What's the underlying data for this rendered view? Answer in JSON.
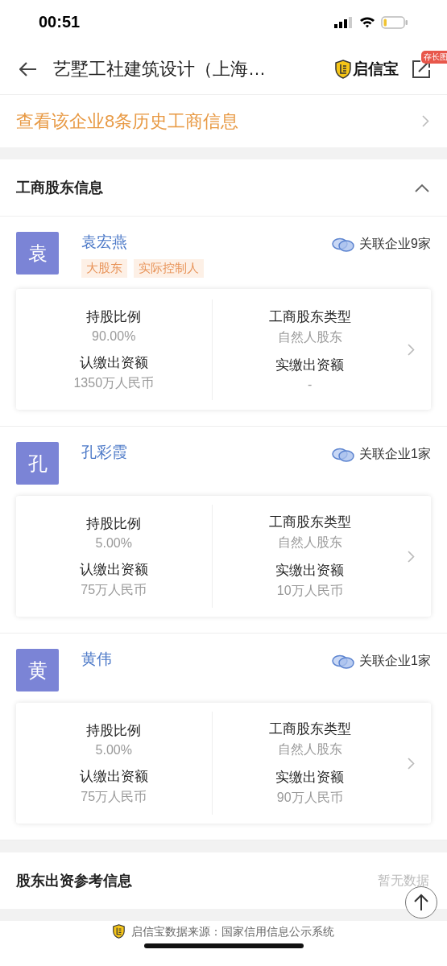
{
  "status_bar": {
    "time": "00:51"
  },
  "nav": {
    "title": "艺墅工社建筑设计（上海…",
    "brand": "启信宝",
    "badge": "存长图"
  },
  "history_link": "查看该企业8条历史工商信息",
  "section": {
    "title": "工商股东信息",
    "expanded": true
  },
  "shareholders": [
    {
      "avatar": "袁",
      "name": "袁宏燕",
      "tags": [
        "大股东",
        "实际控制人"
      ],
      "related": "关联企业9家",
      "fields": [
        {
          "label": "持股比例",
          "value": "90.00%"
        },
        {
          "label": "工商股东类型",
          "value": "自然人股东"
        },
        {
          "label": "认缴出资额",
          "value": "1350万人民币"
        },
        {
          "label": "实缴出资额",
          "value": "-"
        }
      ]
    },
    {
      "avatar": "孔",
      "name": "孔彩霞",
      "related": "关联企业1家",
      "fields": [
        {
          "label": "持股比例",
          "value": "5.00%"
        },
        {
          "label": "工商股东类型",
          "value": "自然人股东"
        },
        {
          "label": "认缴出资额",
          "value": "75万人民币"
        },
        {
          "label": "实缴出资额",
          "value": "10万人民币"
        }
      ]
    },
    {
      "avatar": "黄",
      "name": "黄伟",
      "related": "关联企业1家",
      "fields": [
        {
          "label": "持股比例",
          "value": "5.00%"
        },
        {
          "label": "工商股东类型",
          "value": "自然人股东"
        },
        {
          "label": "认缴出资额",
          "value": "75万人民币"
        },
        {
          "label": "实缴出资额",
          "value": "90万人民币"
        }
      ]
    }
  ],
  "reference": {
    "title": "股东出资参考信息",
    "value": "暂无数据"
  },
  "footer": "启信宝数据来源：国家信用信息公示系统"
}
